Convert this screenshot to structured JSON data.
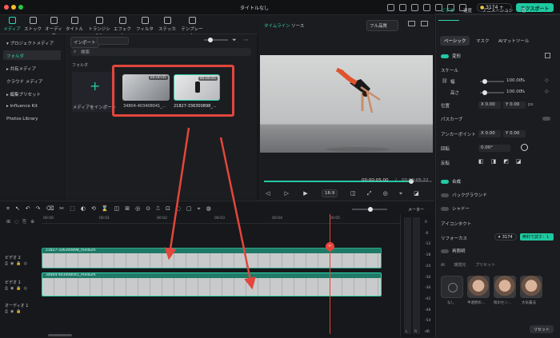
{
  "window": {
    "title": "タイトルなし",
    "export_label": "エクスポート",
    "credits": "3174"
  },
  "nav": {
    "tabs": [
      "メディア",
      "ストック",
      "オーディオ",
      "タイトル",
      "トランジション",
      "エフェクト",
      "フィルター",
      "ステッカー",
      "テンプレート"
    ]
  },
  "sidebar": {
    "items": [
      "プロジェクトメディア",
      "フォルダ",
      "共有メディア",
      "クラウド メディア",
      "編集プリセット",
      "Influence Kit",
      "Photos Library"
    ]
  },
  "media": {
    "import_label": "インポート",
    "search_placeholder": "検索",
    "folder_label": "フォルダ",
    "import_card_label": "メディアをインポート",
    "clips": [
      {
        "name": "34804-403408041_...",
        "duration": "00:00:05"
      },
      {
        "name": "21827-336300898_...",
        "duration": "00:00:05"
      }
    ]
  },
  "preview": {
    "tabs": [
      "タイムライン",
      "ソース"
    ],
    "quality": "フル品質",
    "timecode": "00:00:05:00",
    "total": "00:00:05:22",
    "ratio": "16:9"
  },
  "props": {
    "tabs": [
      "ビデオ",
      "速度",
      "アニメーション",
      "色"
    ],
    "subtabs": [
      "ベーシック",
      "マスク",
      "AIマットツール"
    ],
    "transform": "変形",
    "scale": "スケール",
    "width": "幅",
    "height": "高さ",
    "scale_w": "100.00",
    "scale_h": "100.00",
    "pct": "%",
    "position": "位置",
    "pos_x": "0.00",
    "pos_y": "0.00",
    "path_curve": "パスカーブ",
    "anchor": "アンカーポイント",
    "anc_x": "0.00",
    "anc_y": "0.00",
    "rotate": "回転",
    "rotate_val": "0.00°",
    "flip": "反転",
    "composite": "合成",
    "background": "バックグラウンド",
    "shadow": "シャドー",
    "ai_contact": "アイコンタクト",
    "reforcus": "リフォーカス",
    "ai_credit": "3174",
    "try_free": "無料で試す：1",
    "relight": "再照明",
    "ai_tabs": [
      "AI",
      "環境光",
      "プリセット"
    ],
    "faces": [
      "なし",
      "半透明の...",
      "暗のセン...",
      "大気霧法"
    ],
    "reset": "リセット",
    "x_label": "X",
    "y_label": "Y",
    "px": "px"
  },
  "timeline": {
    "ticks": [
      "00:00",
      "00:01",
      "00:02",
      "00:03",
      "00:04",
      "00:05"
    ],
    "tracks": [
      {
        "label": "ビデオ 2",
        "clip": "21827-336300898_medium"
      },
      {
        "label": "ビデオ 1",
        "clip": "34804-403408041_medium"
      },
      {
        "label": "オーディオ 1",
        "clip": ""
      }
    ],
    "meter_label": "メーター",
    "db": [
      "0",
      "-6",
      "-12",
      "-18",
      "-24",
      "-30",
      "-36",
      "-42",
      "-48",
      "-54",
      "dB"
    ],
    "lr": [
      "L",
      "R"
    ]
  },
  "colors": {
    "accent": "#22c9a4",
    "annotation": "#e2463c"
  }
}
